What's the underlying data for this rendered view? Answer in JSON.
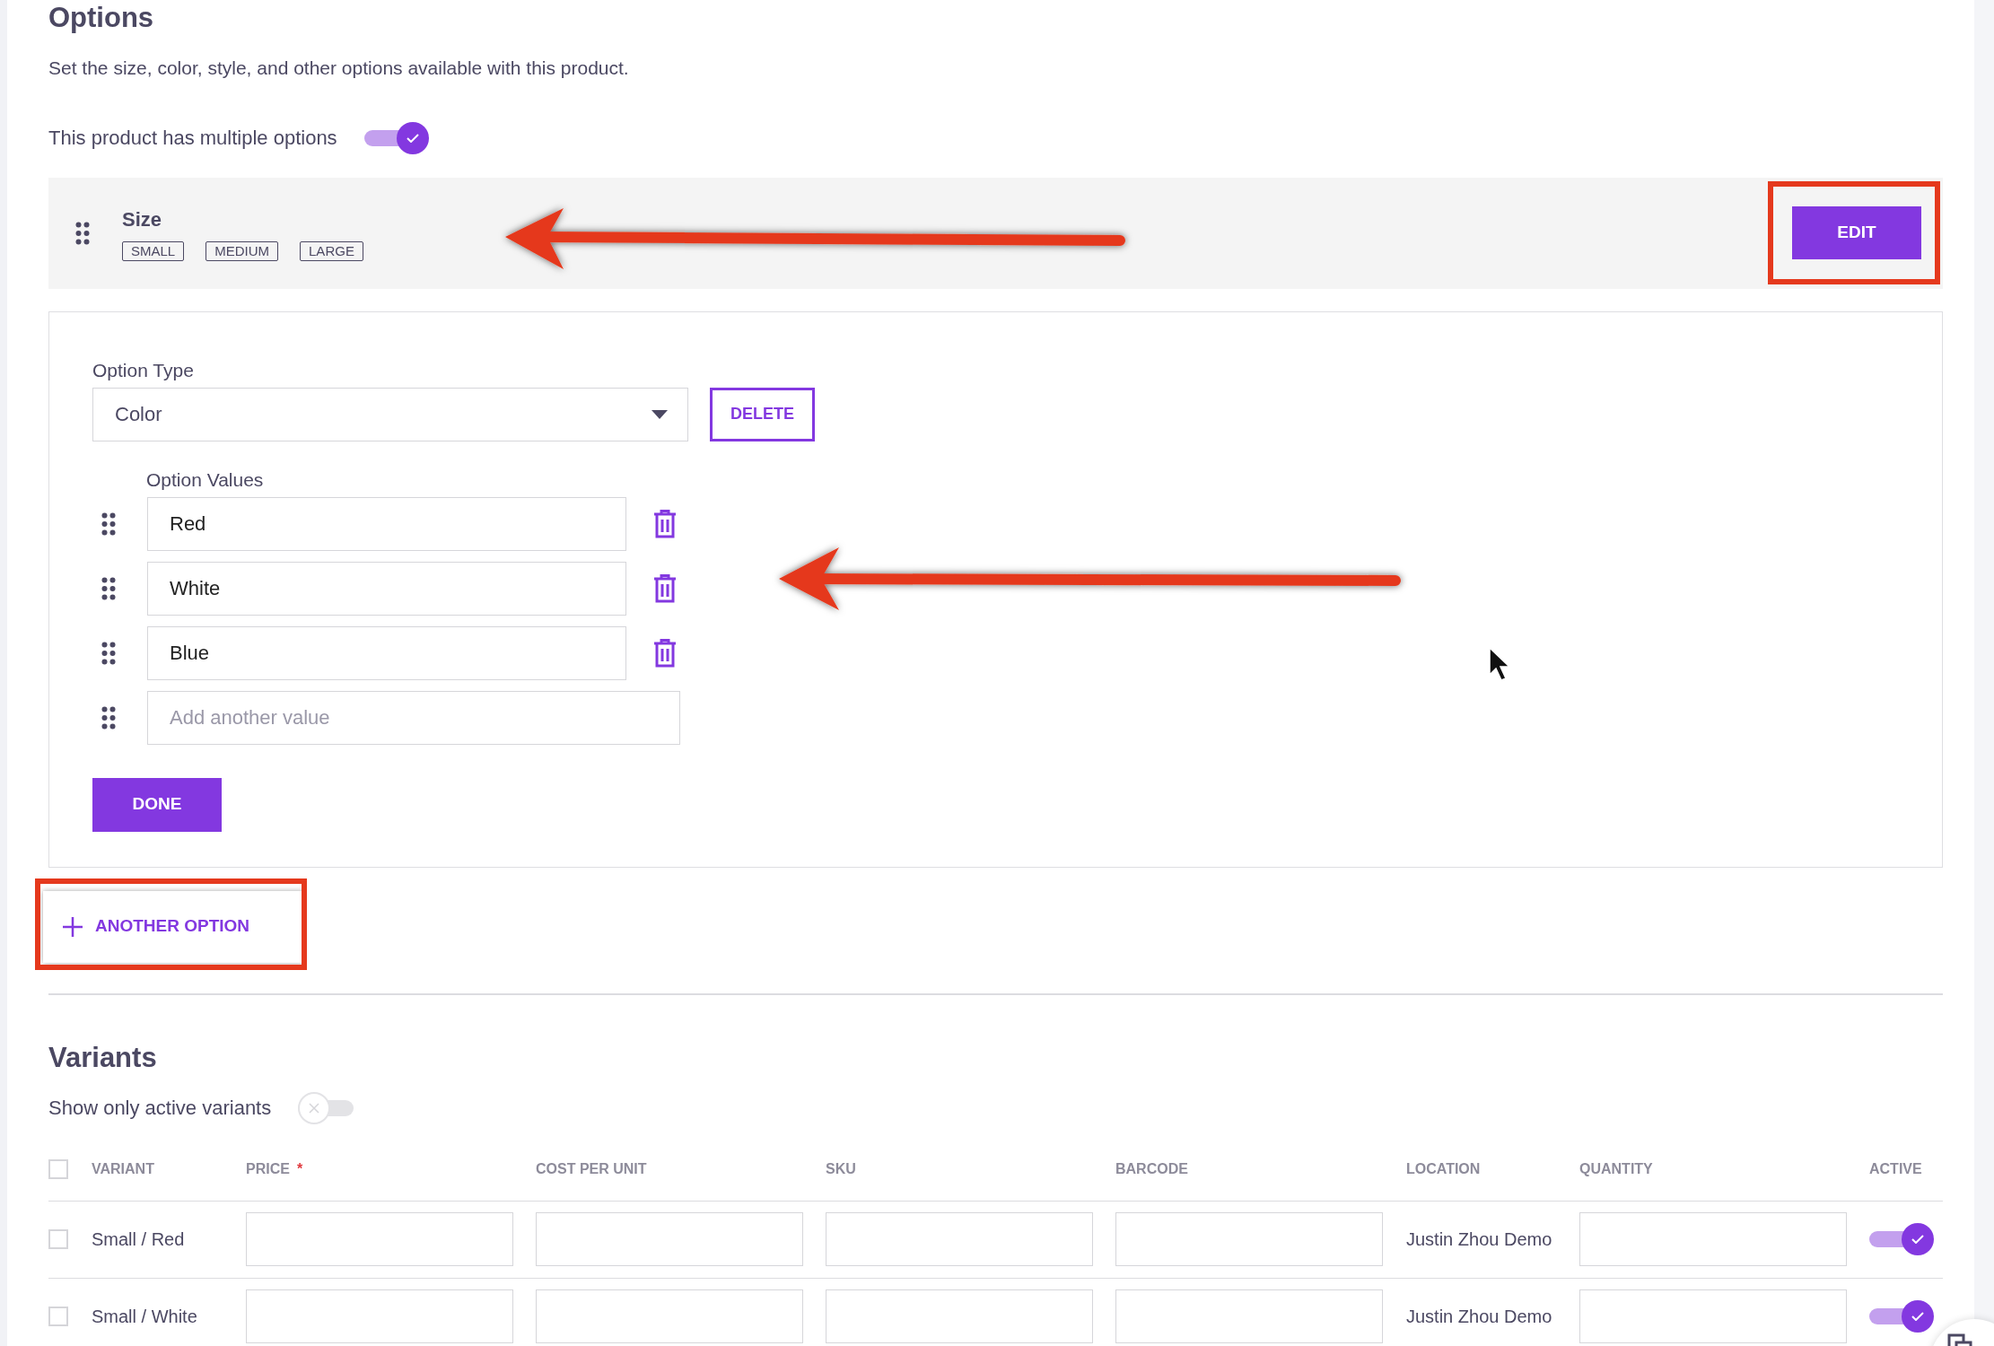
{
  "options": {
    "title": "Options",
    "description": "Set the size, color, style, and other options available with this product.",
    "multiple_toggle": {
      "label": "This product has multiple options",
      "on": true
    },
    "option_list": [
      {
        "name": "Size",
        "values": [
          "SMALL",
          "MEDIUM",
          "LARGE"
        ],
        "button": "EDIT"
      }
    ],
    "editor": {
      "type_label": "Option Type",
      "type_value": "Color",
      "delete_button": "DELETE",
      "values_label": "Option Values",
      "values": [
        "Red",
        "White",
        "Blue"
      ],
      "new_value": {
        "placeholder": "Add another value"
      },
      "done_button": "DONE"
    },
    "add_button": "ANOTHER OPTION"
  },
  "variants": {
    "title": "Variants",
    "active_toggle": {
      "label": "Show only active variants",
      "on": false
    },
    "table": {
      "select_all_checked": false,
      "columns": [
        {
          "label": "VARIANT"
        },
        {
          "label": "PRICE",
          "required_mark": "*"
        },
        {
          "label": "COST PER UNIT"
        },
        {
          "label": "SKU"
        },
        {
          "label": "BARCODE"
        },
        {
          "label": "LOCATION"
        },
        {
          "label": "QUANTITY"
        },
        {
          "label": "ACTIVE"
        }
      ],
      "rows": [
        {
          "checked": false,
          "variant": "Small / Red",
          "location": "Justin Zhou Demo",
          "active": true
        },
        {
          "checked": false,
          "variant": "Small / White",
          "location": "Justin Zhou Demo",
          "active": true
        }
      ]
    }
  }
}
